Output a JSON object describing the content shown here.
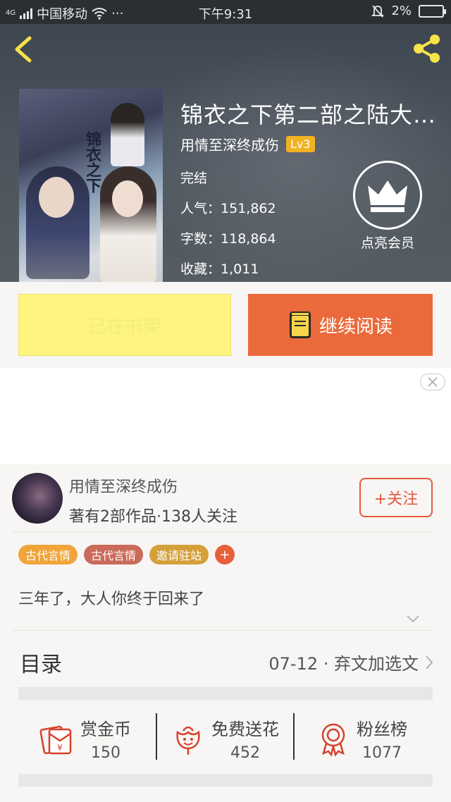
{
  "status_bar": {
    "signal_tag": "4G",
    "carrier": "中国移动",
    "more": "···",
    "time": "下午9:31",
    "battery": "2%"
  },
  "book": {
    "title": "锦衣之下第二部之陆大人...",
    "author": "用情至深终成伤",
    "level": "Lv3",
    "status": "完结",
    "popularity_label": "人气：",
    "popularity": "151,862",
    "words_label": "字数：",
    "words": "118,864",
    "favorites_label": "收藏：",
    "favorites": "1,011",
    "cover_text": "锦衣之下"
  },
  "vip": {
    "label": "点亮会员"
  },
  "actions": {
    "shelf_label": "已在书架",
    "read_label": "继续阅读"
  },
  "author_card": {
    "name": "用情至深终成伤",
    "stats": "著有2部作品·138人关注",
    "follow_label": "+关注"
  },
  "tags": [
    {
      "label": "古代言情",
      "color": "#f0a43a"
    },
    {
      "label": "古代言情",
      "color": "#c96a5a"
    },
    {
      "label": "邀请驻站",
      "color": "#d4a03a"
    }
  ],
  "tag_add": "+",
  "intro": "三年了，大人你终于回来了",
  "toc": {
    "label": "目录",
    "latest": "07-12 · 弃文加选文"
  },
  "stats": {
    "reward": {
      "label": "赏金币",
      "value": "150"
    },
    "flowers": {
      "label": "免费送花",
      "value": "452"
    },
    "fans": {
      "label": "粉丝榜",
      "value": "1077"
    }
  },
  "colors": {
    "accent_orange": "#ea6a3b",
    "shelf_yellow": "#fdf57f",
    "icon_yellow": "#f7e34a",
    "icon_red": "#d8402a"
  }
}
